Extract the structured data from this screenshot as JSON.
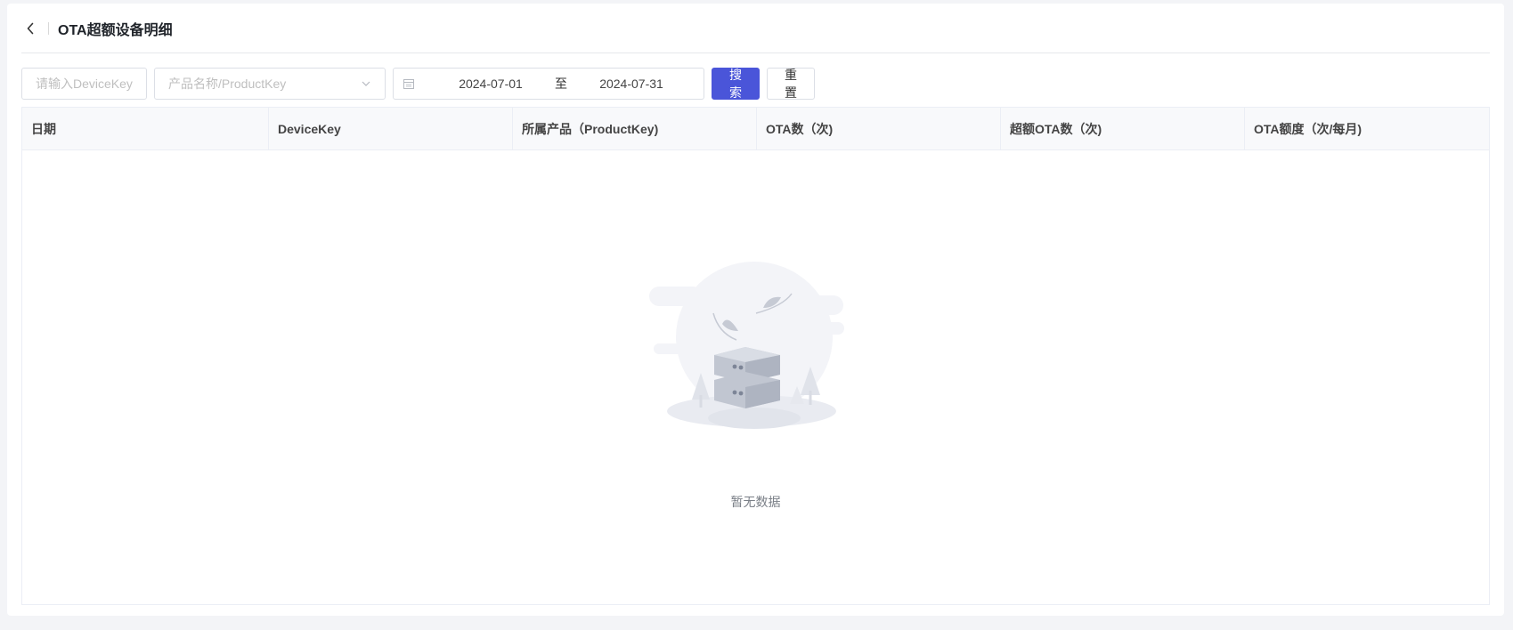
{
  "header": {
    "title": "OTA超额设备明细"
  },
  "filters": {
    "device_key_placeholder": "请输入DeviceKey",
    "product_placeholder": "产品名称/ProductKey",
    "date_start": "2024-07-01",
    "date_separator": "至",
    "date_end": "2024-07-31",
    "search_label": "搜索",
    "reset_label": "重置"
  },
  "table": {
    "columns": [
      "日期",
      "DeviceKey",
      "所属产品（ProductKey)",
      "OTA数（次)",
      "超额OTA数（次)",
      "OTA额度（次/每月)"
    ],
    "rows": [],
    "empty_text": "暂无数据"
  },
  "colors": {
    "primary": "#4a55d9",
    "page_bg": "#f3f4f7",
    "table_header_bg": "#f8f9fb"
  },
  "icons": {
    "back": "chevron-left-icon",
    "select": "chevron-down-icon",
    "calendar": "calendar-icon",
    "empty": "empty-server-illustration"
  }
}
